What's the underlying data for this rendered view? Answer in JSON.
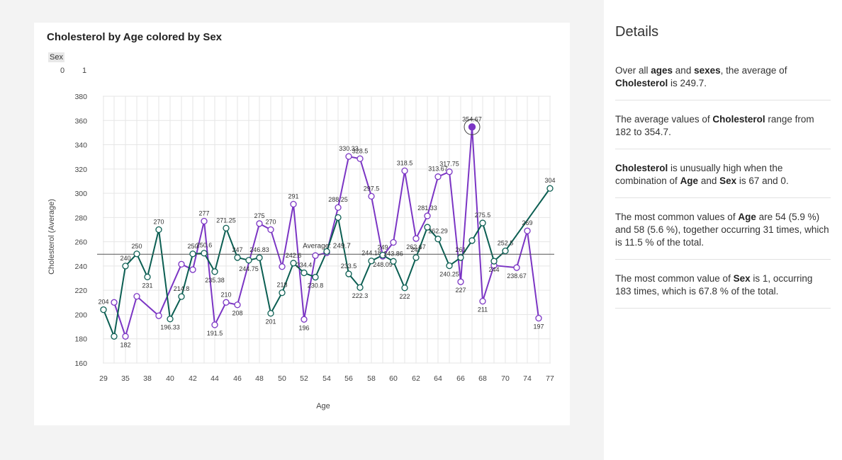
{
  "chart_data": {
    "type": "line",
    "title": "Cholesterol by Age colored by Sex",
    "xlabel": "Age",
    "ylabel": "Cholesterol (Average)",
    "ylim": [
      160,
      380
    ],
    "y_ticks": [
      160,
      180,
      200,
      220,
      240,
      260,
      280,
      300,
      320,
      340,
      360,
      380
    ],
    "x_tick_labels": [
      "29",
      "35",
      "38",
      "40",
      "42",
      "44",
      "46",
      "48",
      "50",
      "52",
      "54",
      "56",
      "58",
      "60",
      "62",
      "64",
      "66",
      "68",
      "70",
      "74",
      "77"
    ],
    "grid": true,
    "legend_title": "Sex",
    "legend_labels": [
      "0",
      "1"
    ],
    "average_line": {
      "value": 249.7,
      "label": "Average: 249.7"
    },
    "highlight": {
      "series": "0",
      "x": "67",
      "value": 354.67
    },
    "series": [
      {
        "name": "0",
        "color": "#7b35c4",
        "x": [
          "34",
          "35",
          "37",
          "39",
          "41",
          "42",
          "43",
          "44",
          "45",
          "46",
          "48",
          "49",
          "50",
          "51",
          "52",
          "53",
          "54",
          "55",
          "56",
          "57",
          "58",
          "59",
          "60",
          "61",
          "62",
          "63",
          "64",
          "65",
          "66",
          "67",
          "68",
          "69",
          "71",
          "74",
          "76"
        ],
        "values": [
          210,
          182,
          215,
          199,
          241.5,
          237,
          277,
          191.5,
          210,
          208,
          275,
          270,
          239.5,
          291,
          196,
          248.6,
          251,
          288.25,
          330.33,
          328.5,
          297.5,
          248.09,
          259.5,
          318.5,
          262.67,
          281.33,
          313.67,
          317.75,
          227,
          354.67,
          211,
          240.5,
          238.67,
          269,
          197
        ],
        "labels": [
          "",
          "182",
          "",
          "",
          "",
          "",
          "277",
          "191.5",
          "210",
          "208",
          "275",
          "270",
          "",
          "291",
          "196",
          "",
          "",
          "288.25",
          "330.33",
          "328.5",
          "297.5",
          "248.09",
          "",
          "318.5",
          "262.67",
          "281.33",
          "313.67",
          "317.75",
          "227",
          "354.67",
          "211",
          "",
          "238.67",
          "269",
          "197"
        ]
      },
      {
        "name": "1",
        "color": "#0b5e52",
        "x": [
          "29",
          "34",
          "35",
          "37",
          "38",
          "39",
          "40",
          "41",
          "42",
          "43",
          "44",
          "45",
          "46",
          "47",
          "48",
          "49",
          "50",
          "51",
          "52",
          "53",
          "54",
          "55",
          "56",
          "57",
          "58",
          "59",
          "60",
          "61",
          "62",
          "63",
          "64",
          "65",
          "66",
          "67",
          "68",
          "69",
          "70",
          "77"
        ],
        "values": [
          204,
          182,
          240,
          250,
          231,
          270,
          196.33,
          214.8,
          250,
          250.6,
          235.38,
          271.25,
          247,
          244.75,
          246.83,
          201,
          218,
          242.4,
          234.4,
          230.8,
          252,
          280,
          233.5,
          222.3,
          244.18,
          249,
          243.86,
          222,
          247,
          272,
          262.29,
          240.25,
          247,
          261,
          275.5,
          244,
          252.5,
          304
        ],
        "labels": [
          "204",
          "",
          "240",
          "250",
          "231",
          "270",
          "196.33",
          "214.8",
          "250",
          "250.6",
          "235.38",
          "271.25",
          "247",
          "244.75",
          "246.83",
          "201",
          "218",
          "242.6",
          "234.4",
          "230.8",
          "",
          "",
          "233.5",
          "222.3",
          "244.18",
          "249",
          "243.86",
          "222",
          "247",
          "",
          "262.29",
          "240.25",
          "261",
          "",
          "275.5",
          "244",
          "252.5",
          "304"
        ]
      }
    ]
  },
  "details": {
    "title": "Details",
    "insights": [
      [
        {
          "t": "Over all "
        },
        {
          "t": "ages",
          "b": true
        },
        {
          "t": " and "
        },
        {
          "t": "sexes",
          "b": true
        },
        {
          "t": ", the average of "
        },
        {
          "t": "Cholesterol",
          "b": true
        },
        {
          "t": " is 249.7."
        }
      ],
      [
        {
          "t": "The average values of "
        },
        {
          "t": "Cholesterol",
          "b": true
        },
        {
          "t": " range from 182 to 354.7."
        }
      ],
      [
        {
          "t": "Cholesterol",
          "b": true
        },
        {
          "t": " is unusually high when the combination of "
        },
        {
          "t": "Age",
          "b": true
        },
        {
          "t": " and "
        },
        {
          "t": "Sex",
          "b": true
        },
        {
          "t": " is 67 and 0."
        }
      ],
      [
        {
          "t": "The most common values of "
        },
        {
          "t": "Age",
          "b": true
        },
        {
          "t": " are 54 (5.9 %) and 58 (5.6 %), together occurring 31 times, which is 11.5 % of the total."
        }
      ],
      [
        {
          "t": "The most common value of "
        },
        {
          "t": "Sex",
          "b": true
        },
        {
          "t": " is 1, occurring 183 times, which is 67.8 % of the total."
        }
      ]
    ]
  }
}
